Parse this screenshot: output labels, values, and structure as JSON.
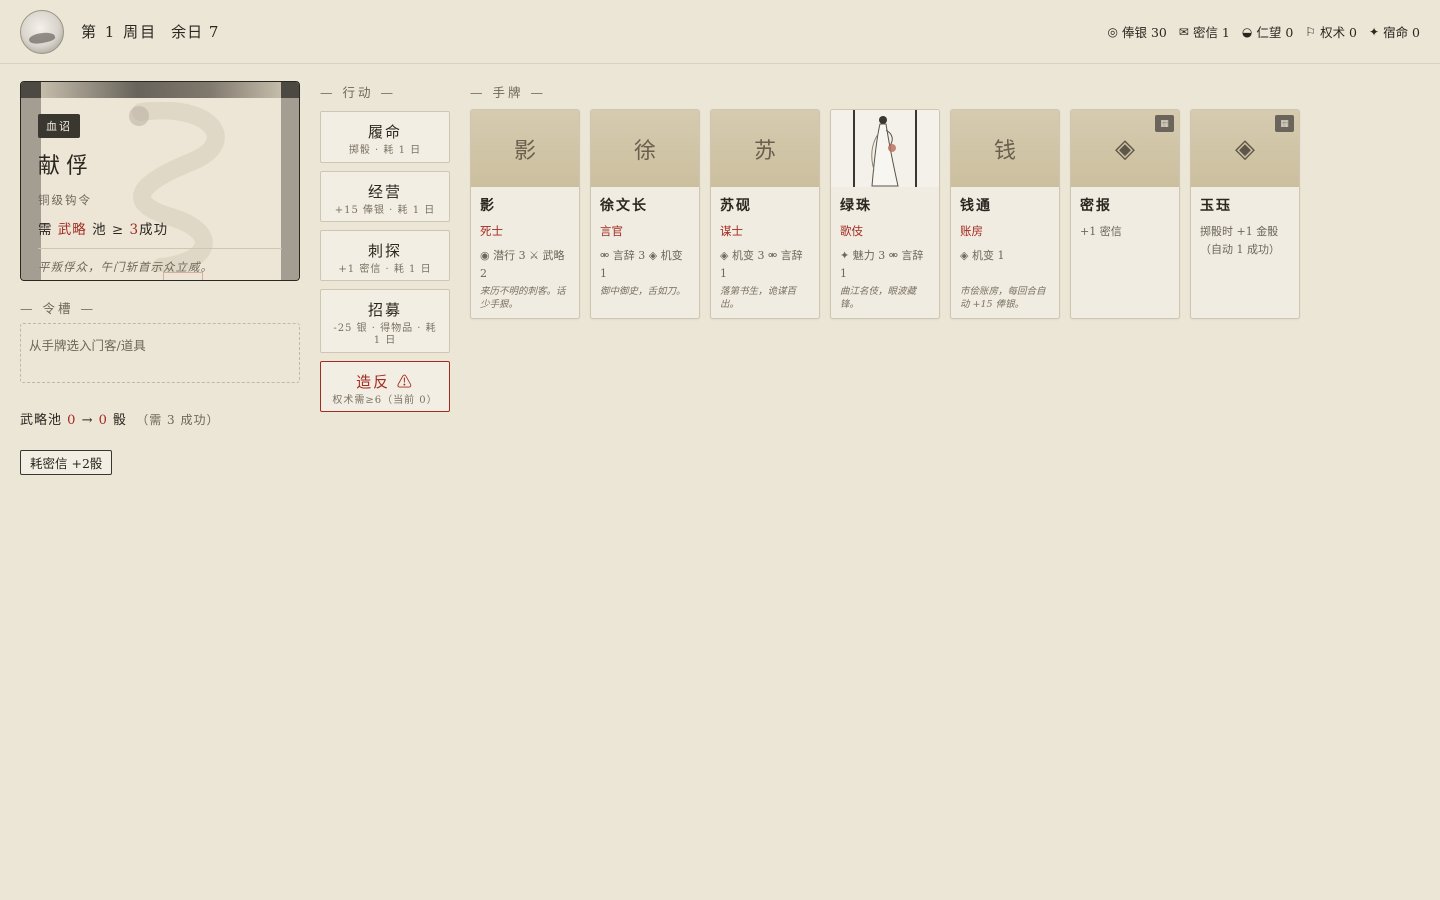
{
  "header": {
    "week": "第 1 周目",
    "days_left": "余日 7",
    "stats": [
      {
        "icon": "◎",
        "icon_name": "silver-coin-icon",
        "label": "俸银 30"
      },
      {
        "icon": "✉",
        "icon_name": "letter-icon",
        "label": "密信 1"
      },
      {
        "icon": "◒",
        "icon_name": "yin-yang-icon",
        "label": "仁望 0"
      },
      {
        "icon": "⚐",
        "icon_name": "flag-icon",
        "label": "权术 0"
      },
      {
        "icon": "✦",
        "icon_name": "star-icon",
        "label": "宿命 0"
      }
    ]
  },
  "edict": {
    "badge": "血诏",
    "title": "献俘",
    "subtitle": "铜级钩令",
    "req_prefix": "需",
    "req_pool": "武略",
    "req_mid": "池 ≥",
    "req_num": "3",
    "req_suffix": "成功",
    "flavor": "平叛俘众，午门斩首示众立威。"
  },
  "sections": {
    "actions_title": "— 行动 —",
    "hand_title": "— 手牌 —",
    "slot_title": "— 令槽 —"
  },
  "slot": {
    "placeholder": "从手牌选入门客/道具"
  },
  "pool": {
    "label": "武略池",
    "from": "0",
    "arrow": "→",
    "to": "0",
    "unit": "骰",
    "note": "（需 3 成功）"
  },
  "spend_button": "耗密信 +2骰",
  "actions": [
    {
      "name": "履命",
      "desc": "掷骰 · 耗 1 日"
    },
    {
      "name": "经营",
      "desc": "+15 俸银 · 耗 1 日"
    },
    {
      "name": "刺探",
      "desc": "+1 密信 · 耗 1 日"
    },
    {
      "name": "招募",
      "desc": "-25 银 · 得物品 · 耗 1 日"
    },
    {
      "name": "造反 ⚠",
      "desc": "权术需≥6（当前 0）"
    }
  ],
  "cards": [
    {
      "glyph": "影",
      "name": "影",
      "role": "死士",
      "skills": "◉ 潜行 3 ⚔ 武略 2",
      "flavor": "来历不明的刺客。话少手狠。"
    },
    {
      "glyph": "徐",
      "name": "徐文长",
      "role": "言官",
      "skills": "⚮ 言辞 3 ◈ 机变 1",
      "flavor": "御中御史，舌如刀。"
    },
    {
      "glyph": "苏",
      "name": "苏砚",
      "role": "谋士",
      "skills": "◈ 机变 3 ⚮ 言辞 1",
      "flavor": "落第书生，诡谋百出。"
    },
    {
      "glyph": "",
      "name": "绿珠",
      "role": "歌伎",
      "skills": "✦ 魅力 3 ⚮ 言辞 1",
      "flavor": "曲江名伎，眼波藏锋。"
    },
    {
      "glyph": "钱",
      "name": "钱通",
      "role": "账房",
      "skills": "◈ 机变 1",
      "flavor": "市侩账房，每回合自动 +15 俸银。"
    },
    {
      "glyph": "◈",
      "name": "密报",
      "role": "",
      "skills": "+1 密信",
      "flavor": ""
    },
    {
      "glyph": "◈",
      "name": "玉珏",
      "role": "",
      "skills": "掷骰时 +1 金骰（自动 1 成功）",
      "flavor": ""
    }
  ]
}
